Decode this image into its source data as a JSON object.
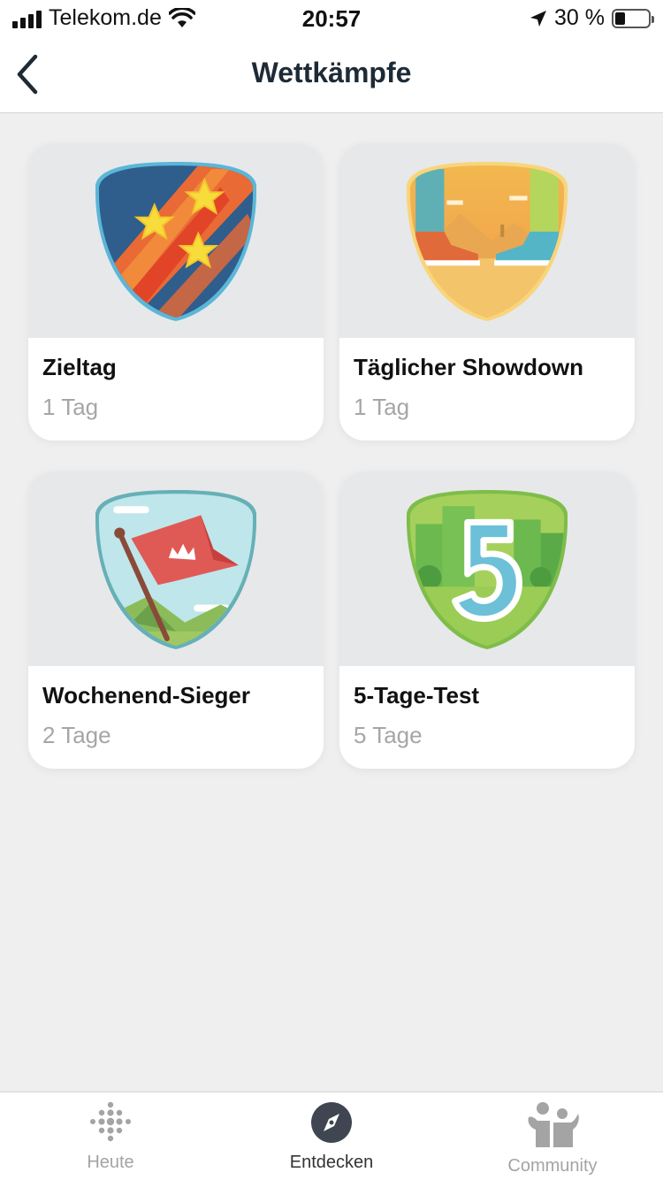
{
  "status_bar": {
    "carrier": "Telekom.de",
    "time": "20:57",
    "battery_text": "30 %",
    "battery_level": 0.3,
    "icons": [
      "signal-icon",
      "wifi-icon",
      "location-arrow-icon",
      "battery-icon"
    ]
  },
  "nav": {
    "title": "Wettkämpfe",
    "back_icon": "chevron-left-icon"
  },
  "challenges": [
    {
      "title": "Zieltag",
      "duration": "1 Tag",
      "badge": "shooting-stars-badge"
    },
    {
      "title": "Täglicher Showdown",
      "duration": "1 Tag",
      "badge": "desert-sneakers-badge"
    },
    {
      "title": "Wochenend-Sieger",
      "duration": "2 Tage",
      "badge": "crown-flag-badge"
    },
    {
      "title": "5-Tage-Test",
      "duration": "5 Tage",
      "badge": "five-city-badge"
    }
  ],
  "tabs": [
    {
      "label": "Heute",
      "icon": "fitbit-dots-icon",
      "active": false
    },
    {
      "label": "Entdecken",
      "icon": "compass-icon",
      "active": true
    },
    {
      "label": "Community",
      "icon": "people-icon",
      "active": false
    }
  ],
  "colors": {
    "accent_dark": "#1e2b36",
    "inactive_tab": "#a4a4a4",
    "background": "#efefef"
  }
}
